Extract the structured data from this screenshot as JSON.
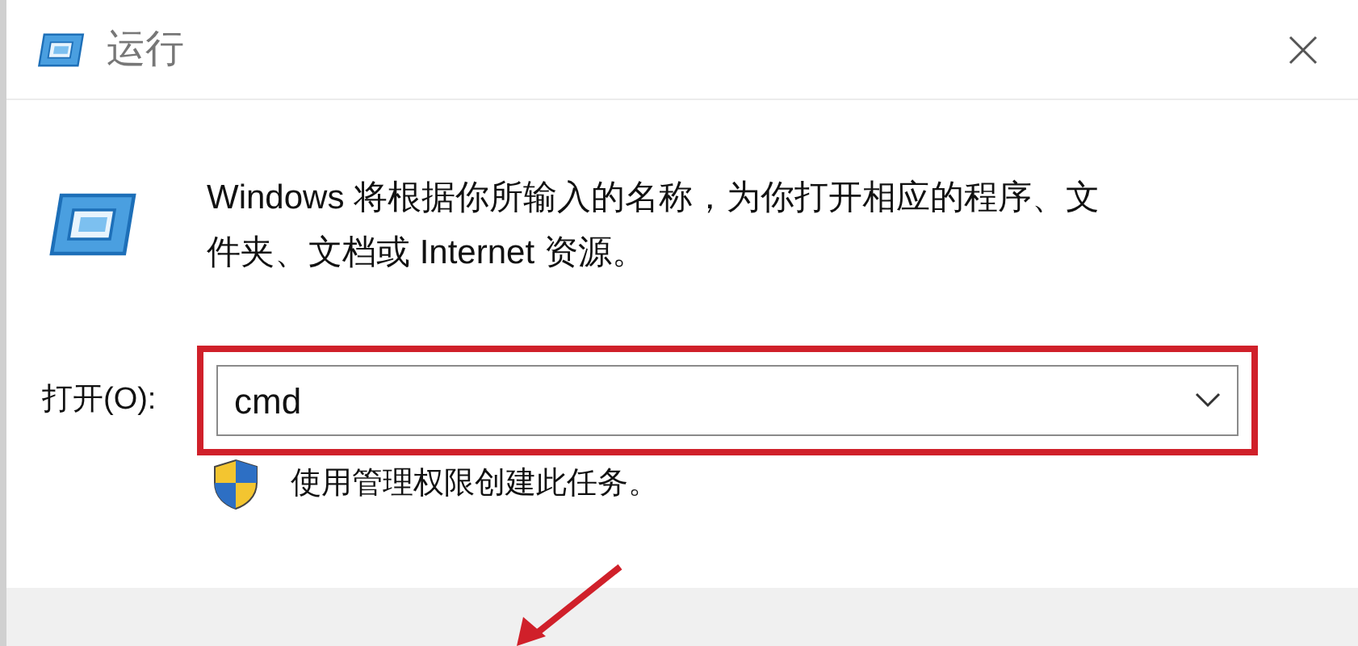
{
  "window": {
    "title": "运行"
  },
  "description": "Windows 将根据你所输入的名称，为你打开相应的程序、文件夹、文档或 Internet 资源。",
  "open_field": {
    "label": "打开(O):",
    "value": "cmd",
    "highlighted": true
  },
  "admin_note": "使用管理权限创建此任务。"
}
